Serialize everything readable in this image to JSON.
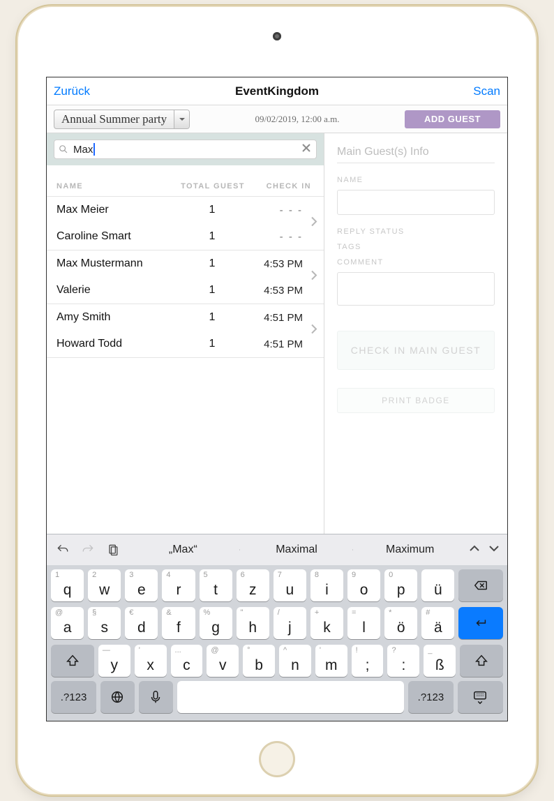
{
  "navbar": {
    "back": "Zurück",
    "title": "EventKingdom",
    "scan": "Scan"
  },
  "subbar": {
    "event_name": "Annual Summer party",
    "timestamp": "09/02/2019, 12:00 a.m.",
    "add_guest": "ADD GUEST"
  },
  "search": {
    "query": "Max"
  },
  "table": {
    "headers": {
      "name": "NAME",
      "total": "TOTAL GUEST",
      "checkin": "CHECK IN"
    },
    "groups": [
      {
        "rows": [
          {
            "name": "Max Meier",
            "total": "1",
            "checkin": "- - -",
            "empty": true
          },
          {
            "name": "Caroline Smart",
            "total": "1",
            "checkin": "- - -",
            "empty": true
          }
        ]
      },
      {
        "rows": [
          {
            "name": "Max Mustermann",
            "total": "1",
            "checkin": "4:53 PM"
          },
          {
            "name": "Valerie",
            "total": "1",
            "checkin": "4:53 PM"
          }
        ]
      },
      {
        "rows": [
          {
            "name": "Amy Smith",
            "total": "1",
            "checkin": "4:51 PM"
          },
          {
            "name": "Howard Todd",
            "total": "1",
            "checkin": "4:51 PM"
          }
        ]
      }
    ]
  },
  "detail": {
    "heading": "Main Guest(s) Info",
    "name_label": "NAME",
    "reply_label": "REPLY STATUS",
    "tags_label": "TAGS",
    "comment_label": "COMMENT",
    "checkin_btn": "CHECK IN MAIN GUEST",
    "print_btn": "PRINT BADGE"
  },
  "keyboard": {
    "suggestions": [
      "„Max“",
      "Maximal",
      "Maximum"
    ],
    "row1": [
      {
        "main": "q",
        "hint": "1"
      },
      {
        "main": "w",
        "hint": "2"
      },
      {
        "main": "e",
        "hint": "3"
      },
      {
        "main": "r",
        "hint": "4"
      },
      {
        "main": "t",
        "hint": "5"
      },
      {
        "main": "z",
        "hint": "6"
      },
      {
        "main": "u",
        "hint": "7"
      },
      {
        "main": "i",
        "hint": "8"
      },
      {
        "main": "o",
        "hint": "9"
      },
      {
        "main": "p",
        "hint": "0"
      },
      {
        "main": "ü",
        "hint": ""
      }
    ],
    "row2": [
      {
        "main": "a",
        "hint": "@"
      },
      {
        "main": "s",
        "hint": "§"
      },
      {
        "main": "d",
        "hint": "€"
      },
      {
        "main": "f",
        "hint": "&"
      },
      {
        "main": "g",
        "hint": "%"
      },
      {
        "main": "h",
        "hint": "\""
      },
      {
        "main": "j",
        "hint": "/"
      },
      {
        "main": "k",
        "hint": "+"
      },
      {
        "main": "l",
        "hint": "="
      },
      {
        "main": "ö",
        "hint": "*"
      },
      {
        "main": "ä",
        "hint": "#"
      }
    ],
    "row3": [
      {
        "main": "y",
        "hint": "—"
      },
      {
        "main": "x",
        "hint": "'"
      },
      {
        "main": "c",
        "hint": "..."
      },
      {
        "main": "v",
        "hint": "@"
      },
      {
        "main": "b",
        "hint": "°"
      },
      {
        "main": "n",
        "hint": "^"
      },
      {
        "main": "m",
        "hint": "'"
      },
      {
        "main": ";",
        "hint": "!"
      },
      {
        "main": ":",
        "hint": "?"
      },
      {
        "main": "ß",
        "hint": "_"
      }
    ],
    "symbol_key": ".?123"
  }
}
